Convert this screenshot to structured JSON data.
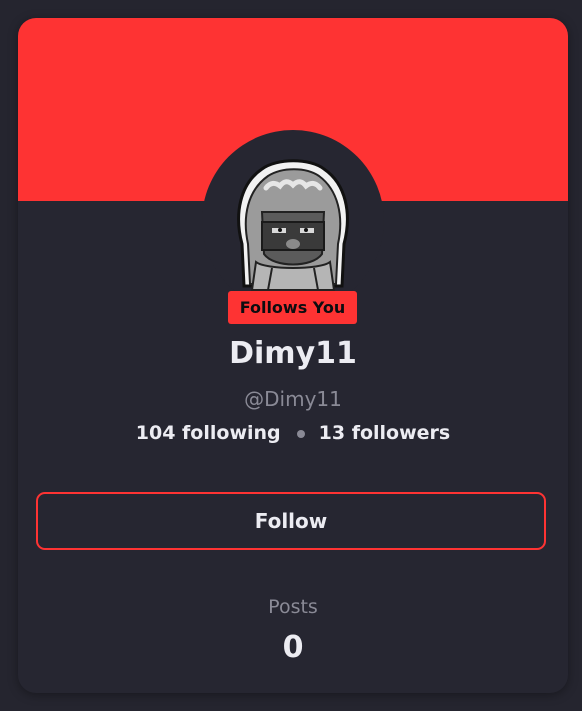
{
  "profile": {
    "display_name": "Dimy11",
    "handle": "@Dimy11",
    "follows_you_badge": "Follows You",
    "following_text": "104 following",
    "followers_text": "13 followers",
    "follow_button_label": "Follow",
    "posts_label": "Posts",
    "posts_count": "0",
    "avatar_icon": "hooded-ninja-avatar"
  },
  "colors": {
    "accent": "#fe3333",
    "card_background": "#262631",
    "text_primary": "#ececf2",
    "text_muted": "#8a8a96"
  }
}
